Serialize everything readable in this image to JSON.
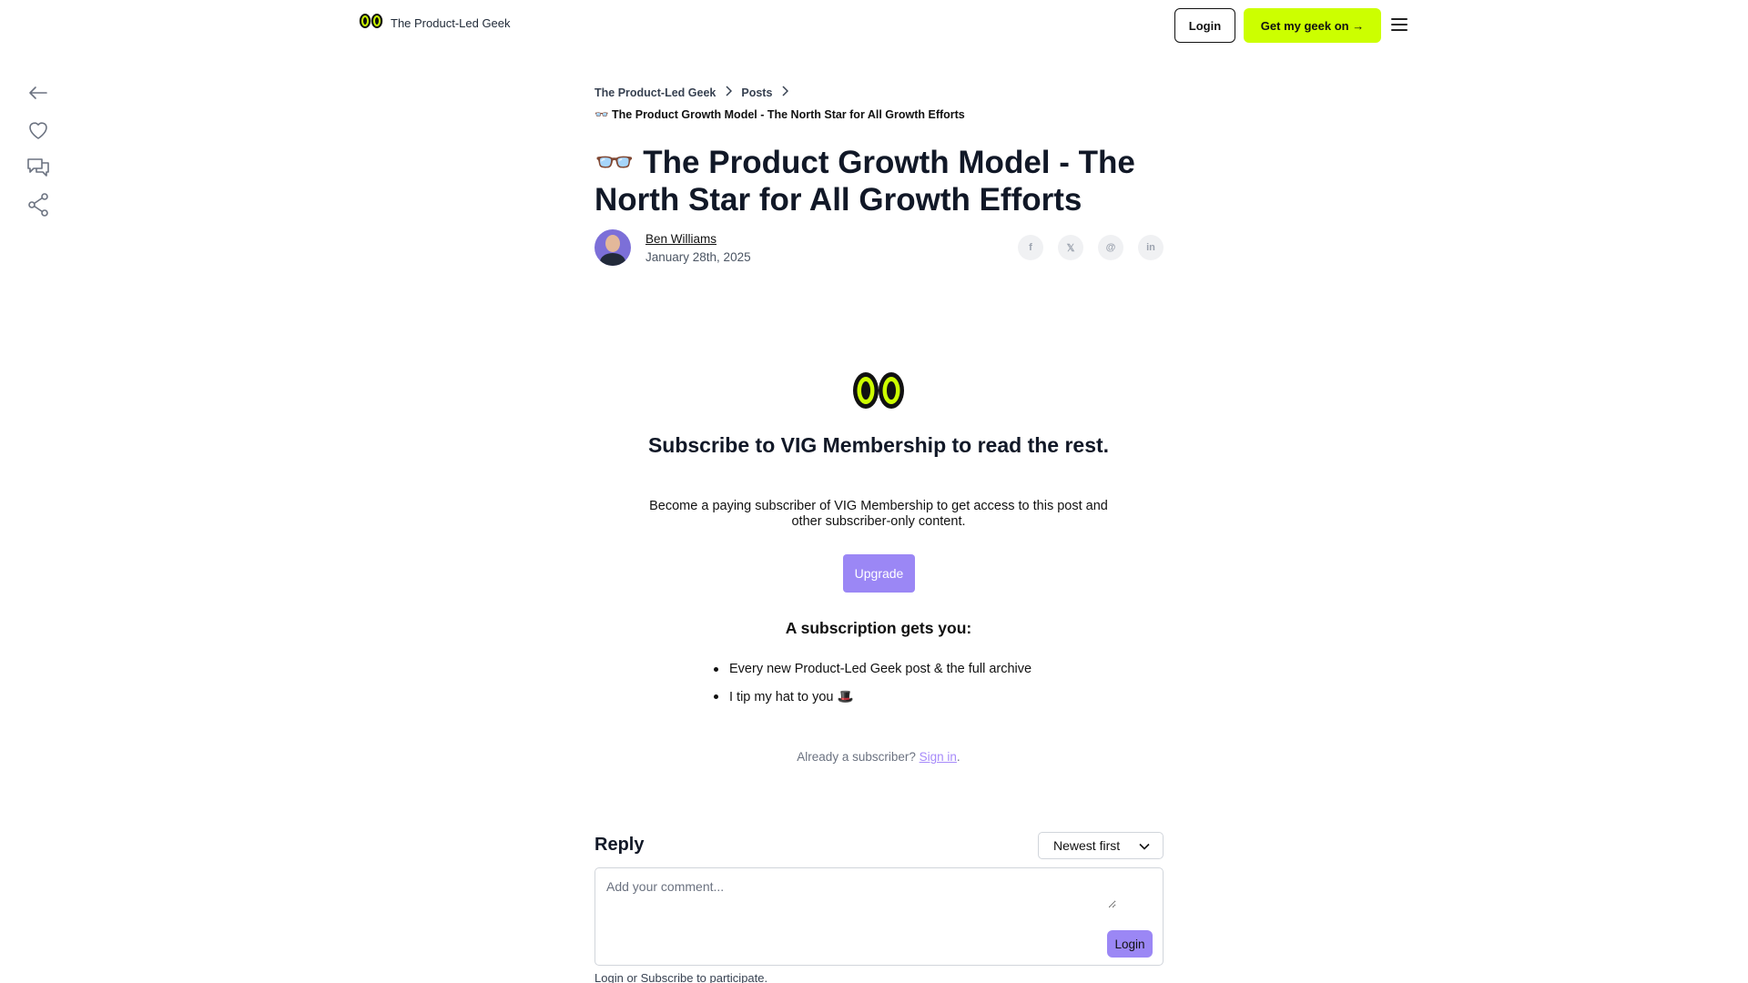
{
  "header": {
    "brand_name": "The Product-Led Geek",
    "login_label": "Login",
    "cta_label": "Get my geek on →"
  },
  "left_rail": {
    "icons": [
      "back-arrow-icon",
      "heart-icon",
      "comment-icon",
      "share-icon"
    ]
  },
  "breadcrumb": {
    "items": [
      "The Product-Led Geek",
      "Posts"
    ],
    "current": "👓 The Product Growth Model - The North Star for All Growth Efforts"
  },
  "article": {
    "title": "👓 The Product Growth Model - The North Star for All Growth Efforts",
    "author_name": "Ben Williams",
    "date": "January 28th, 2025",
    "share": {
      "facebook": "f",
      "x": "𝕏",
      "threads": "@",
      "linkedin": "in"
    }
  },
  "paywall": {
    "title": "Subscribe to VIG Membership to read the rest.",
    "description": "Become a paying subscriber of VIG Membership to get access to this post and other subscriber-only content.",
    "upgrade_label": "Upgrade",
    "benefits_title": "A subscription gets you:",
    "benefits": [
      "Every new Product-Led Geek post & the full archive",
      "I tip my hat to you 🎩"
    ],
    "already_text": "Already a subscriber?",
    "sign_in_label": "Sign in",
    "sign_in_suffix": "."
  },
  "reply": {
    "title": "Reply",
    "sort_label": "Newest first",
    "placeholder": "Add your comment...",
    "login_label": "Login",
    "participate_login": "Login",
    "participate_or": "or",
    "participate_subscribe": "Subscribe",
    "participate_suffix": "to participate."
  },
  "colors": {
    "accent_lime": "#ccff00",
    "accent_purple": "#9b87f5",
    "text_dark": "#111827"
  }
}
